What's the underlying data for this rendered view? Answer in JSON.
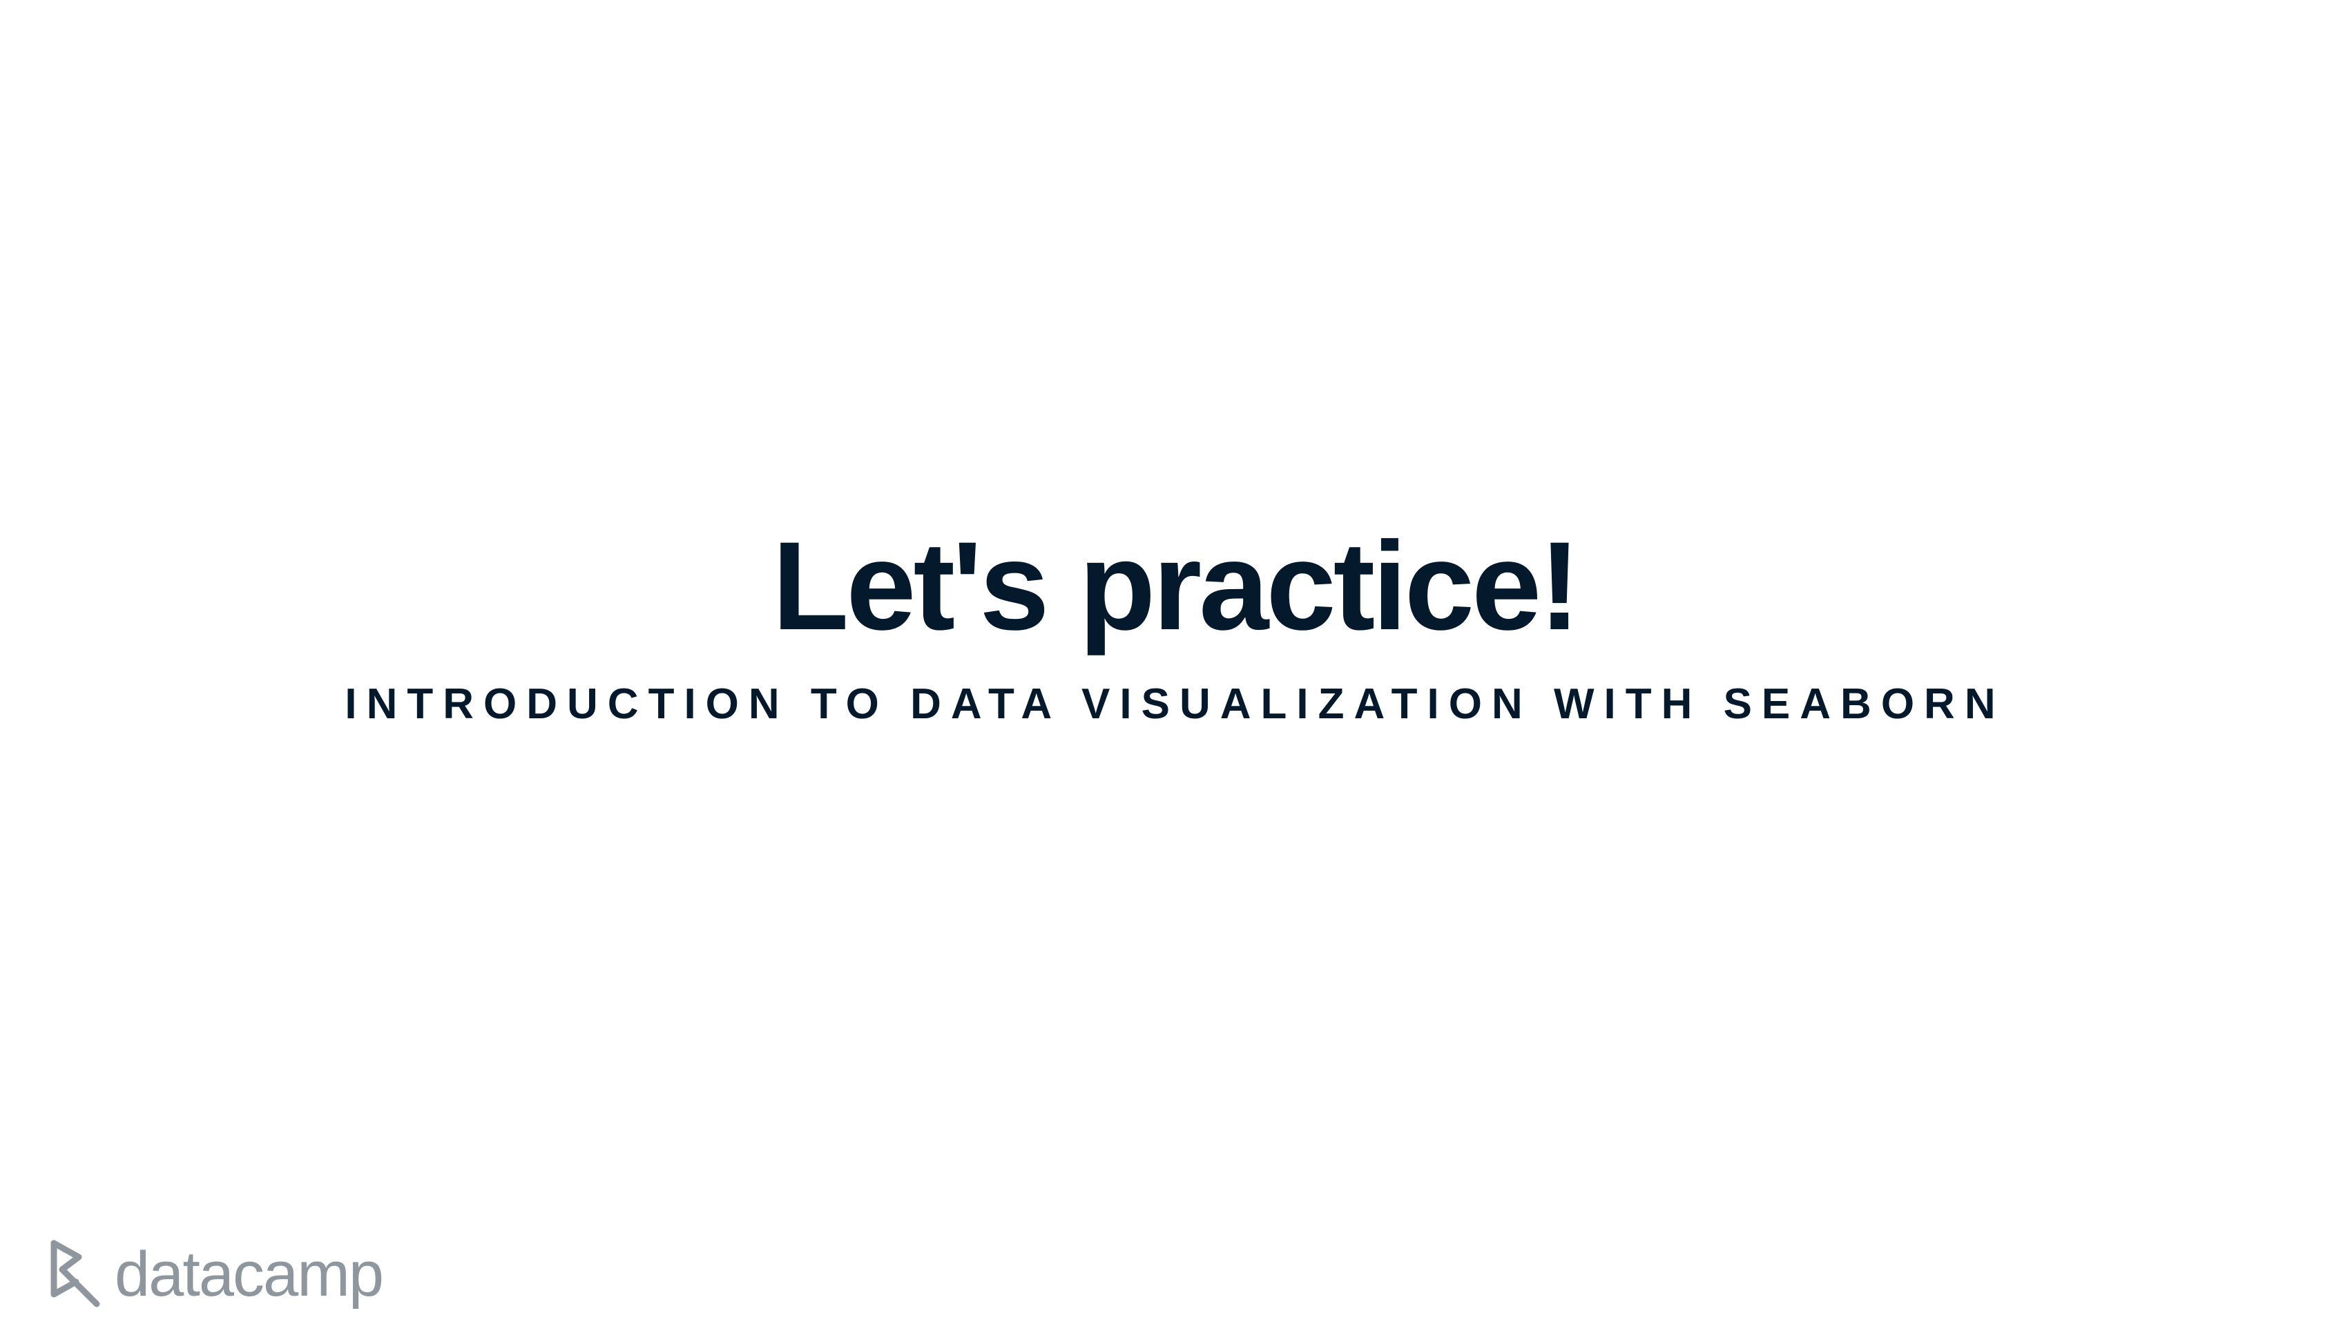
{
  "slide": {
    "title": "Let's practice!",
    "subtitle": "INTRODUCTION TO DATA VISUALIZATION WITH SEABORN"
  },
  "brand": {
    "logo_icon": "datacamp-logo-icon",
    "wordmark": "datacamp"
  },
  "colors": {
    "background": "#ffffff",
    "text_primary": "#05192d",
    "logo_gray": "#8e979e"
  }
}
